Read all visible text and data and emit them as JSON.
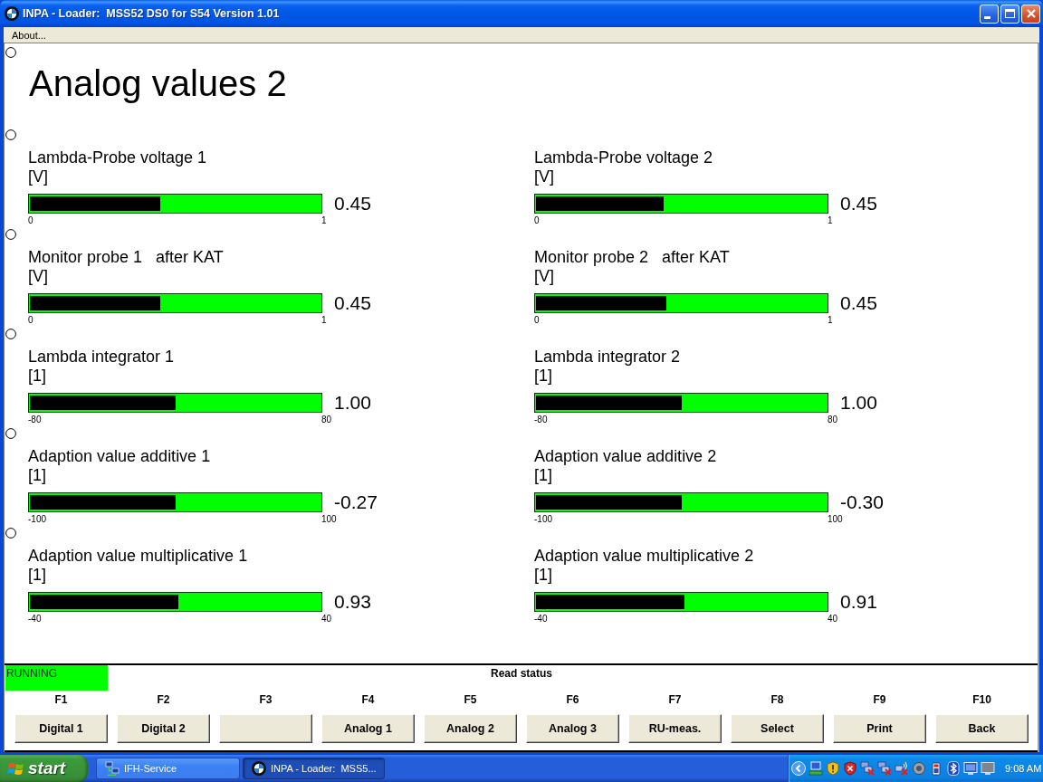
{
  "window": {
    "title": "INPA - Loader:  MSS52 DS0 for S54 Version 1.01"
  },
  "menu_bar": {
    "items": [
      {
        "label": "About..."
      }
    ]
  },
  "page": {
    "heading": "Analog values 2"
  },
  "gauge_rows": [
    {
      "gauges": [
        {
          "label": "Lambda-Probe voltage 1",
          "unit": "[V]",
          "level": 0.45,
          "scale_min": "0",
          "scale_max": "1",
          "reading": "0.45"
        },
        {
          "label": "Lambda-Probe voltage 2",
          "unit": "[V]",
          "level": 0.44,
          "scale_min": "0",
          "scale_max": "1",
          "reading": "0.45"
        }
      ]
    },
    {
      "gauges": [
        {
          "label": "Monitor probe 1   after KAT",
          "unit": "[V]",
          "level": 0.45,
          "scale_min": "0",
          "scale_max": "1",
          "reading": "0.45"
        },
        {
          "label": "Monitor probe 2   after KAT",
          "unit": "[V]",
          "level": 0.45,
          "scale_min": "0",
          "scale_max": "1",
          "reading": "0.45"
        }
      ]
    },
    {
      "gauges": [
        {
          "label": "Lambda integrator 1",
          "unit": "[1]",
          "level": 0.5,
          "scale_min": "-80",
          "scale_max": "80",
          "reading": "1.00"
        },
        {
          "label": "Lambda integrator 2",
          "unit": "[1]",
          "level": 0.5,
          "scale_min": "-80",
          "scale_max": "80",
          "reading": "1.00"
        }
      ]
    },
    {
      "gauges": [
        {
          "label": "Adaption value additive 1",
          "unit": "[1]",
          "level": 0.5,
          "scale_min": "-100",
          "scale_max": "100",
          "reading": "-0.27"
        },
        {
          "label": "Adaption value additive 2",
          "unit": "[1]",
          "level": 0.5,
          "scale_min": "-100",
          "scale_max": "100",
          "reading": "-0.30"
        }
      ]
    },
    {
      "gauges": [
        {
          "label": "Adaption value multiplicative 1",
          "unit": "[1]",
          "level": 0.51,
          "scale_min": "-40",
          "scale_max": "40",
          "reading": "0.93"
        },
        {
          "label": "Adaption value multiplicative 2",
          "unit": "[1]",
          "level": 0.51,
          "scale_min": "-40",
          "scale_max": "40",
          "reading": "0.91"
        }
      ]
    }
  ],
  "status": {
    "state": "RUNNING",
    "message": "Read status"
  },
  "function_keys": [
    {
      "key": "F1",
      "label": "Digital 1"
    },
    {
      "key": "F2",
      "label": "Digital 2"
    },
    {
      "key": "F3"
    },
    {
      "key": "F4",
      "label": "Analog 1"
    },
    {
      "key": "F5",
      "label": "Analog 2"
    },
    {
      "key": "F6",
      "label": "Analog 3"
    },
    {
      "key": "F7",
      "label": "RU-meas."
    },
    {
      "key": "F8",
      "label": "Select"
    },
    {
      "key": "F9",
      "label": "Print"
    },
    {
      "key": "F10",
      "label": "Back"
    }
  ],
  "taskbar": {
    "start_label": "start",
    "tasks": [
      {
        "label": "IFH-Service",
        "selected": false
      },
      {
        "label": "INPA - Loader:  MSS5...",
        "selected": true
      }
    ],
    "clock": "9:08 AM"
  }
}
